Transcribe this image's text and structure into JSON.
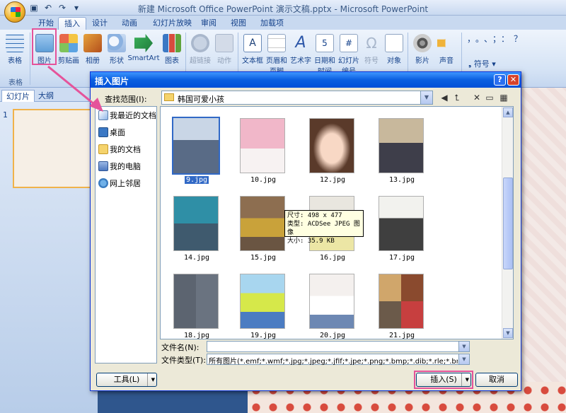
{
  "window": {
    "title": "新建 Microsoft Office PowerPoint 演示文稿.pptx - Microsoft PowerPoint"
  },
  "ribbon_tabs": [
    "开始",
    "插入",
    "设计",
    "动画",
    "幻灯片放映",
    "审阅",
    "视图",
    "加载项"
  ],
  "ribbon": {
    "table": "表格",
    "picture": "图片",
    "clipart": "剪贴画",
    "album": "相册",
    "shapes": "形状",
    "smartart": "SmartArt",
    "chart": "图表",
    "hyperlink": "超链接",
    "action": "动作",
    "textbox": "文本框",
    "header_footer_1": "页眉和",
    "header_footer_2": "页脚",
    "wordart": "艺术字",
    "datetime_1": "日期和",
    "datetime_2": "时间",
    "slidenum_1": "幻灯片",
    "slidenum_2": "编号",
    "symbol": "符号",
    "object": "对象",
    "movie": "影片",
    "sound": "声音",
    "symbols_small": "符号",
    "group_table": "表格"
  },
  "pane_tabs": [
    "幻灯片",
    "大纲"
  ],
  "slide_thumb_number": "1",
  "dialog": {
    "title": "插入图片",
    "lookin_label": "查找范围(I):",
    "lookin_value": "韩国可爱小孩",
    "places": [
      "我最近的文档",
      "桌面",
      "我的文档",
      "我的电脑",
      "网上邻居"
    ],
    "files": [
      "9.jpg",
      "10.jpg",
      "12.jpg",
      "13.jpg",
      "14.jpg",
      "15.jpg",
      "16.jpg",
      "17.jpg",
      "18.jpg",
      "19.jpg",
      "20.jpg",
      "21.jpg"
    ],
    "tooltip": [
      "尺寸: 498 x 477",
      "类型: ACDSee JPEG 图像",
      "大小: 35.9 KB"
    ],
    "filename_label": "文件名(N):",
    "filename_value": "",
    "filetype_label": "文件类型(T):",
    "filetype_value": "所有图片(*.emf;*.wmf;*.jpg;*.jpeg;*.jfif;*.jpe;*.png;*.bmp;*.dib;*.rle;*.bm",
    "tools_button": "工具(L)",
    "insert_button": "插入(S)",
    "cancel_button": "取消"
  },
  "colors": {
    "highlight": "#e5539a",
    "selection": "#3169c6",
    "dialog_title": "#0a5fe0"
  }
}
